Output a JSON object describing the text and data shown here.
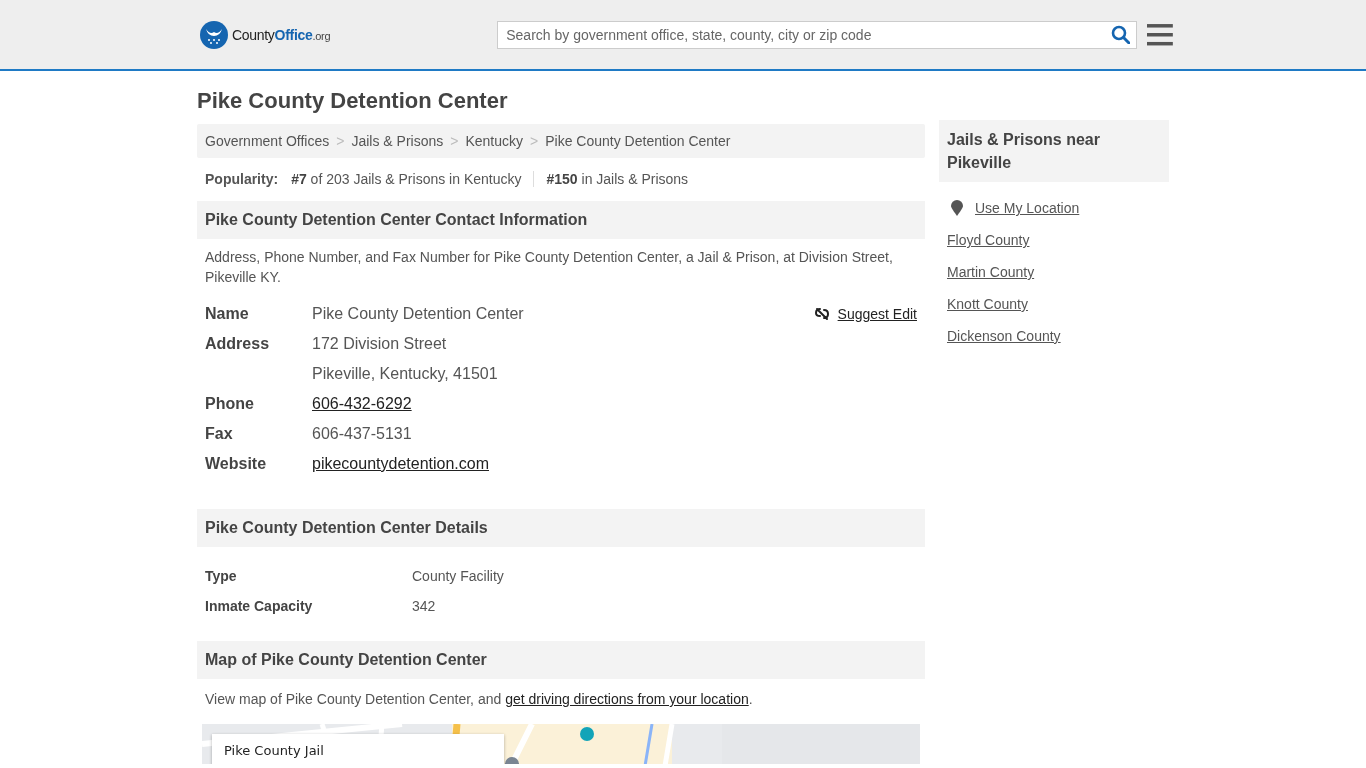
{
  "header": {
    "logo": {
      "parts": [
        "County",
        "Office",
        ".org"
      ]
    },
    "search": {
      "placeholder": "Search by government office, state, county, city or zip code"
    }
  },
  "page_title": "Pike County Detention Center",
  "breadcrumbs": [
    {
      "label": "Government Offices"
    },
    {
      "label": "Jails & Prisons"
    },
    {
      "label": "Kentucky"
    },
    {
      "label": "Pike County Detention Center"
    }
  ],
  "breadcrumb_separator": ">",
  "popularity": {
    "label": "Popularity:",
    "items": [
      "**#7** of 203 Jails & Prisons in Kentucky",
      "**#150** in Jails & Prisons"
    ]
  },
  "contact": {
    "heading": "Pike County Detention Center Contact Information",
    "intro": "Address, Phone Number, and Fax Number for Pike County Detention Center, a Jail & Prison, at Division Street, Pikeville KY.",
    "suggest_edit": "Suggest Edit",
    "fields": [
      {
        "label": "Name",
        "values": [
          "Pike County Detention Center"
        ],
        "kind": "text"
      },
      {
        "label": "Address",
        "values": [
          "172 Division Street",
          "Pikeville, Kentucky, 41501"
        ],
        "kind": "text"
      },
      {
        "label": "Phone",
        "values": [
          "606-432-6292"
        ],
        "kind": "link"
      },
      {
        "label": "Fax",
        "values": [
          "606-437-5131"
        ],
        "kind": "text"
      },
      {
        "label": "Website",
        "values": [
          "pikecountydetention.com"
        ],
        "kind": "link"
      }
    ]
  },
  "details": {
    "heading": "Pike County Detention Center Details",
    "fields": [
      {
        "label": "Type",
        "value": "County Facility"
      },
      {
        "label": "Inmate Capacity",
        "value": "342"
      }
    ]
  },
  "map": {
    "heading": "Map of Pike County Detention Center",
    "intro_before": "View map of Pike County Detention Center, and ",
    "intro_link": "get driving directions from your location",
    "intro_after": ".",
    "kind": "picture",
    "card_title": "Pike County Jail"
  },
  "sidebar": {
    "heading": "Jails & Prisons near Pikeville",
    "use_location": "Use My Location",
    "links": [
      "Floyd County",
      "Martin County",
      "Knott County",
      "Dickenson County"
    ]
  }
}
